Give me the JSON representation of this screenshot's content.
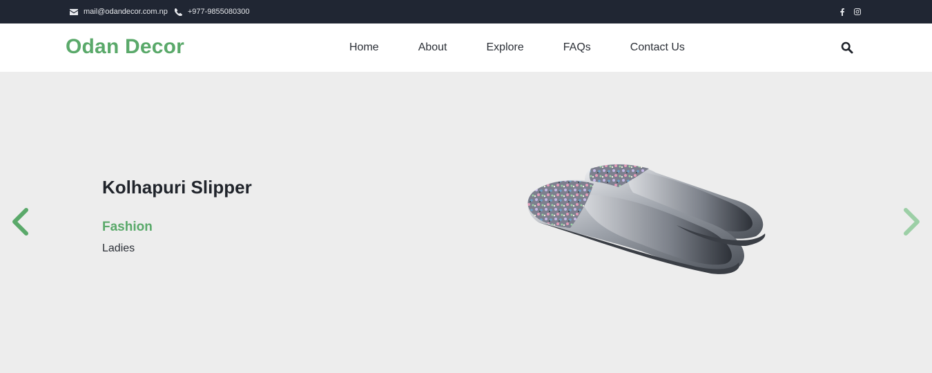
{
  "topbar": {
    "email": "mail@odandecor.com.np",
    "phone": "+977-9855080300",
    "social": [
      "facebook-icon",
      "instagram-icon"
    ]
  },
  "header": {
    "logo": "Odan Decor",
    "nav": [
      "Home",
      "About",
      "Explore",
      "FAQs",
      "Contact Us"
    ]
  },
  "hero": {
    "title": "Kolhapuri Slipper",
    "category": "Fashion",
    "subcategory": "Ladies"
  },
  "colors": {
    "brand": "#5aa96a",
    "topbar_bg": "#202633",
    "hero_bg": "#ededed",
    "heading": "#20242b"
  }
}
